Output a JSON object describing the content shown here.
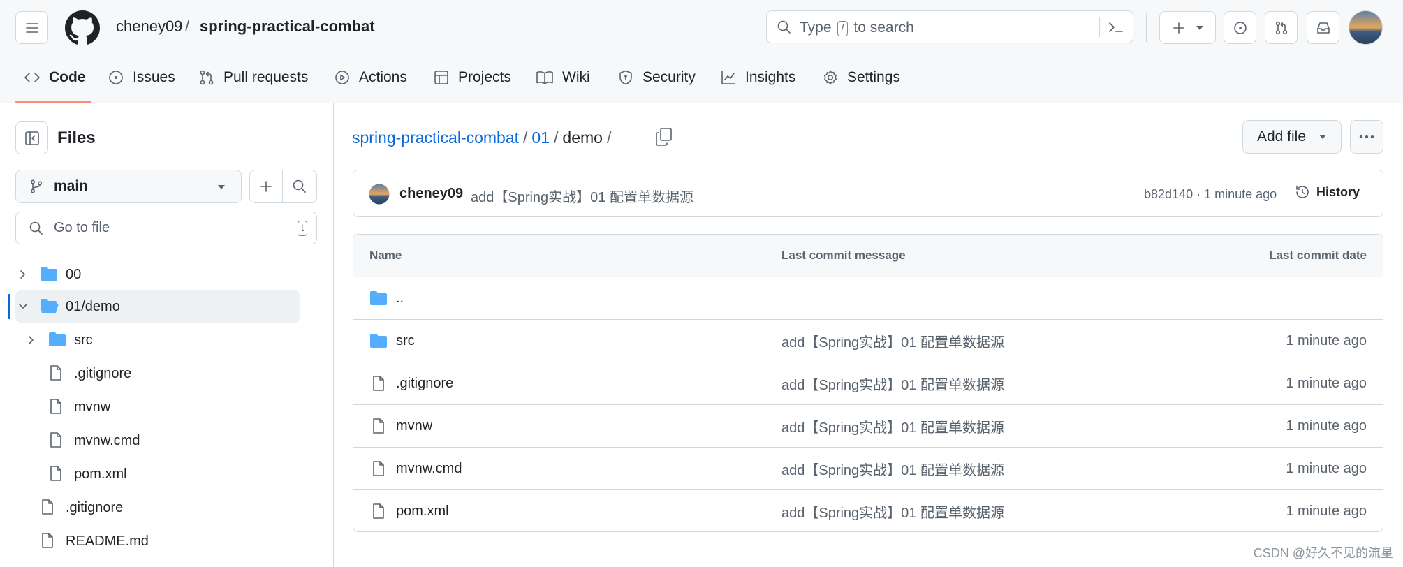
{
  "header": {
    "owner": "cheney09",
    "separator": "/",
    "repo": "spring-practical-combat",
    "search": {
      "prefix": "Type",
      "key": "/",
      "suffix": "to search"
    }
  },
  "tabs": [
    {
      "label": "Code",
      "icon": "code-icon",
      "active": true
    },
    {
      "label": "Issues",
      "icon": "issue-opened-icon"
    },
    {
      "label": "Pull requests",
      "icon": "git-pull-request-icon"
    },
    {
      "label": "Actions",
      "icon": "play-icon"
    },
    {
      "label": "Projects",
      "icon": "table-icon"
    },
    {
      "label": "Wiki",
      "icon": "book-icon"
    },
    {
      "label": "Security",
      "icon": "shield-icon"
    },
    {
      "label": "Insights",
      "icon": "graph-icon"
    },
    {
      "label": "Settings",
      "icon": "gear-icon"
    }
  ],
  "sidebar": {
    "title": "Files",
    "branch": "main",
    "goto_placeholder": "Go to file",
    "goto_key": "t",
    "tree": [
      {
        "label": "00",
        "type": "folder",
        "expanded": false
      },
      {
        "label": "01/demo",
        "type": "folder-open",
        "expanded": true,
        "selected": true
      },
      {
        "label": "src",
        "type": "folder",
        "expanded": false
      },
      {
        "label": ".gitignore",
        "type": "file"
      },
      {
        "label": "mvnw",
        "type": "file"
      },
      {
        "label": "mvnw.cmd",
        "type": "file"
      },
      {
        "label": "pom.xml",
        "type": "file"
      },
      {
        "label": ".gitignore",
        "type": "file"
      },
      {
        "label": "README.md",
        "type": "file"
      }
    ]
  },
  "breadcrumb": {
    "repo": "spring-practical-combat",
    "sep1": "/",
    "folder": "01",
    "sep2": "/",
    "current": "demo",
    "sep3": "/"
  },
  "toolbar": {
    "add_file": "Add file"
  },
  "commit": {
    "author": "cheney09",
    "message": "add【Spring实战】01 配置单数据源",
    "meta": "b82d140 · 1 minute ago",
    "history": "History"
  },
  "table": {
    "headers": {
      "name": "Name",
      "message": "Last commit message",
      "date": "Last commit date"
    },
    "parent": "..",
    "rows": [
      {
        "name": "src",
        "type": "folder",
        "message": "add【Spring实战】01 配置单数据源",
        "date": "1 minute ago"
      },
      {
        "name": ".gitignore",
        "type": "file",
        "message": "add【Spring实战】01 配置单数据源",
        "date": "1 minute ago"
      },
      {
        "name": "mvnw",
        "type": "file",
        "message": "add【Spring实战】01 配置单数据源",
        "date": "1 minute ago"
      },
      {
        "name": "mvnw.cmd",
        "type": "file",
        "message": "add【Spring实战】01 配置单数据源",
        "date": "1 minute ago"
      },
      {
        "name": "pom.xml",
        "type": "file",
        "message": "add【Spring实战】01 配置单数据源",
        "date": "1 minute ago"
      }
    ]
  },
  "watermark": "CSDN @好久不见的流星",
  "colors": {
    "link": "#0969da",
    "folder": "#54aeff",
    "tab_underline": "#fd8c73",
    "selected_bar": "#0969da"
  }
}
